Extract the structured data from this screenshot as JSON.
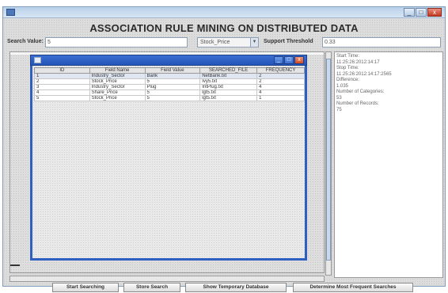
{
  "window": {
    "title_buttons": [
      "_",
      "□",
      "x"
    ]
  },
  "app_title": "ASSOCIATION RULE MINING ON DISTRIBUTED DATA",
  "toolbar": {
    "search_label": "Search Value:",
    "search_value": "5",
    "field_select": "Stock_Price",
    "support_label": "Support Threshold",
    "support_value": "0.33"
  },
  "dialog": {
    "title_buttons": [
      "_",
      "□",
      "x"
    ],
    "table": {
      "headers": [
        "ID",
        "Field Name",
        "Field Value",
        "SEARCHED_FILE",
        "FREQUENCY"
      ],
      "rows": [
        [
          "1",
          "Industry_Sector",
          "Bank",
          "NetBank.txt",
          "2"
        ],
        [
          "2",
          "Stock_Price",
          "5",
          "Ivy5.txt",
          "2"
        ],
        [
          "3",
          "Industry_Sector",
          "Plug",
          "IntPlug.txt",
          "4"
        ],
        [
          "4",
          "Share_Price",
          "5",
          "lgt5.txt",
          "4"
        ],
        [
          "5",
          "Stock_Price",
          "5",
          "lgt5.txt",
          "1"
        ]
      ]
    }
  },
  "log_panel": {
    "lines": [
      "Start Time:",
      "11:25:26:2012:14:17",
      "Stop Time:",
      "11:25:26:2012:14:17:2565",
      "Difference:",
      "1.035",
      "Number of Categories:",
      "53",
      "Number of Records:",
      "75"
    ]
  },
  "bottom_buttons": [
    "Start Searching",
    "Store Search",
    "Show Temporary Database",
    "Determine Most Frequent Searches"
  ]
}
